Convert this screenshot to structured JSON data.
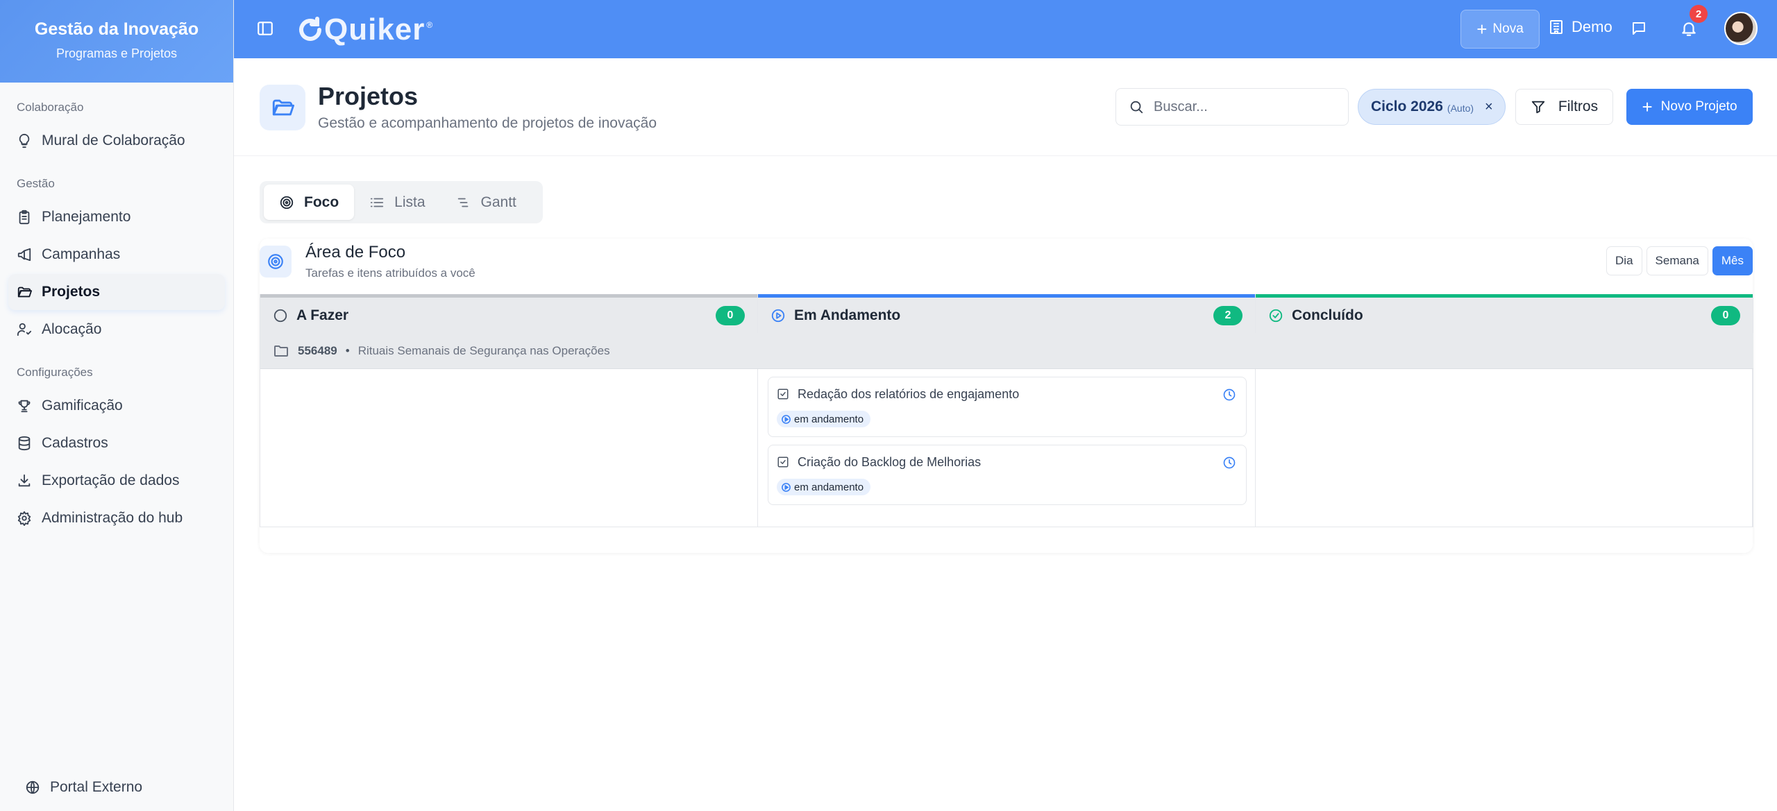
{
  "sidebar": {
    "title": "Gestão da Inovação",
    "subtitle": "Programas e Projetos",
    "sections": [
      {
        "label": "Colaboração",
        "items": [
          {
            "label": "Mural de Colaboração",
            "icon": "lightbulb-icon"
          }
        ]
      },
      {
        "label": "Gestão",
        "items": [
          {
            "label": "Planejamento",
            "icon": "clipboard-icon"
          },
          {
            "label": "Campanhas",
            "icon": "megaphone-icon"
          },
          {
            "label": "Projetos",
            "icon": "folder-icon",
            "active": true
          },
          {
            "label": "Alocação",
            "icon": "user-check-icon"
          }
        ]
      },
      {
        "label": "Configurações",
        "items": [
          {
            "label": "Gamificação",
            "icon": "trophy-icon"
          },
          {
            "label": "Cadastros",
            "icon": "database-icon"
          },
          {
            "label": "Exportação de dados",
            "icon": "download-icon"
          },
          {
            "label": "Administração do hub",
            "icon": "gear-icon"
          }
        ]
      }
    ],
    "footer": {
      "label": "Portal Externo",
      "icon": "globe-icon"
    }
  },
  "topbar": {
    "brand": "Quiker",
    "brand_mark": "®",
    "new_label": "Nova",
    "workspace_label": "Demo",
    "notification_count": "2",
    "colors": {
      "bar": "#4f8ef5",
      "badge": "#ef4444"
    }
  },
  "page": {
    "title": "Projetos",
    "subtitle": "Gestão e acompanhamento de projetos de inovação",
    "search_placeholder": "Buscar...",
    "cycle_label": "Ciclo 2026",
    "cycle_mode": "(Auto)",
    "cycle_remove": "×",
    "filters_label": "Filtros",
    "new_project_label": "Novo Projeto"
  },
  "tabs": [
    {
      "label": "Foco",
      "icon": "target-icon",
      "active": true
    },
    {
      "label": "Lista",
      "icon": "list-icon"
    },
    {
      "label": "Gantt",
      "icon": "gantt-icon"
    }
  ],
  "focus": {
    "title": "Área de Foco",
    "subtitle": "Tarefas e itens atribuídos a você",
    "periods": [
      {
        "label": "Dia"
      },
      {
        "label": "Semana"
      },
      {
        "label": "Mês",
        "active": true
      }
    ],
    "columns": [
      {
        "label": "A Fazer",
        "count": "0",
        "color": "#c4c7cc",
        "icon": "circle-icon"
      },
      {
        "label": "Em Andamento",
        "count": "2",
        "color": "#3b82f6",
        "icon": "play-circle-icon"
      },
      {
        "label": "Concluído",
        "count": "0",
        "color": "#10b981",
        "icon": "check-circle-icon"
      }
    ],
    "group": {
      "id": "556489",
      "separator": "•",
      "name": "Rituais Semanais de Segurança nas Operações"
    },
    "tasks": [
      {
        "name": "Redação dos relatórios de engajamento",
        "status": "em andamento"
      },
      {
        "name": "Criação do Backlog de Melhorias",
        "status": "em andamento"
      }
    ]
  }
}
